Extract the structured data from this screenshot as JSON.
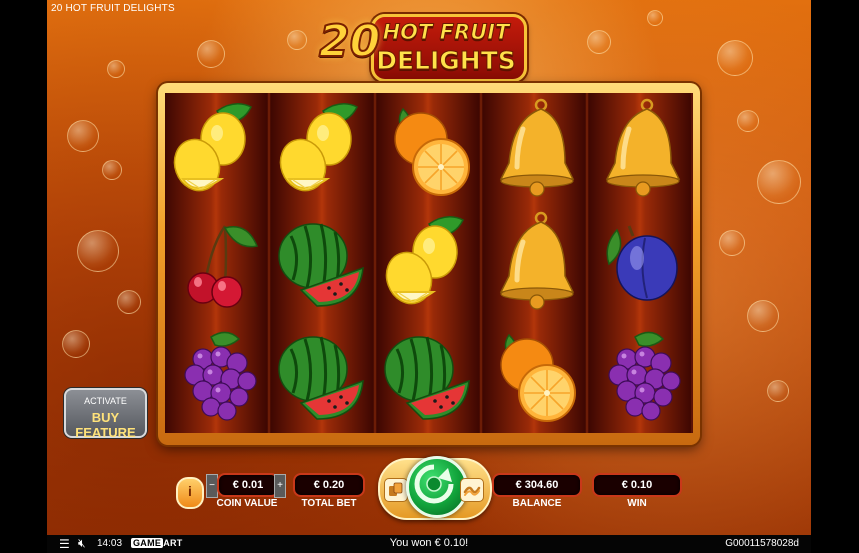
{
  "game": {
    "title": "20 HOT FRUIT DELIGHTS",
    "logo": {
      "number": "20",
      "line1": "HOT FRUIT",
      "line2": "DELIGHTS"
    }
  },
  "reels": [
    [
      "lemon",
      "cherry",
      "grapes"
    ],
    [
      "lemon",
      "watermelon",
      "watermelon"
    ],
    [
      "orange",
      "lemon",
      "watermelon"
    ],
    [
      "bell",
      "bell",
      "orange"
    ],
    [
      "bell",
      "plum",
      "grapes"
    ]
  ],
  "buy_feature": {
    "line1": "ACTIVATE",
    "line2": "BUY FEATURE"
  },
  "controls": {
    "coin_value": {
      "value": "€ 0.01",
      "label": "COIN VALUE",
      "minus": "−",
      "plus": "+"
    },
    "total_bet": {
      "value": "€ 0.20",
      "label": "TOTAL BET"
    },
    "balance": {
      "value": "€ 304.60",
      "label": "BALANCE"
    },
    "win": {
      "value": "€ 0.10",
      "label": "WIN"
    },
    "info_icon": "i"
  },
  "status_bar": {
    "time": "14:03",
    "brand_a": "GAME",
    "brand_b": "ART",
    "message": "You won € 0.10!",
    "round_id": "G00011578028d"
  },
  "colors": {
    "accent": "#ffd23a",
    "spin": "#11a23a",
    "pill_border": "#c8381a"
  }
}
